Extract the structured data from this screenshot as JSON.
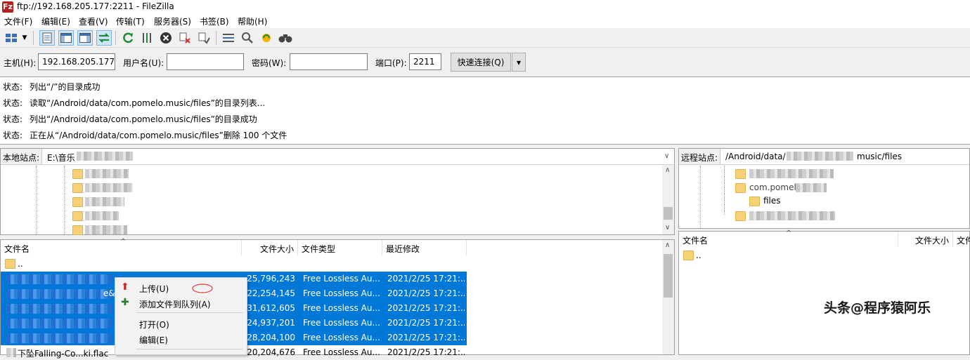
{
  "window": {
    "title": "ftp://192.168.205.177:2211 - FileZilla",
    "app_icon_glyph": "Fz",
    "app_icon_color": "#b51f1f"
  },
  "menu": [
    "文件(F)",
    "编辑(E)",
    "查看(V)",
    "传输(T)",
    "服务器(S)",
    "书签(B)",
    "帮助(H)"
  ],
  "toolbar": {
    "icons": [
      "site-manager-icon",
      "dropdown-arrow-icon",
      "toggle-log-icon",
      "toggle-local-tree-icon",
      "toggle-remote-tree-icon",
      "toggle-transfer-queue-icon",
      "refresh-icon",
      "process-queue-icon",
      "cancel-icon",
      "disconnect-icon",
      "reconnect-icon",
      "directory-filter-icon",
      "compare-directories-icon",
      "sync-browse-icon",
      "search-files-icon"
    ]
  },
  "quickconnect": {
    "host_label": "主机(H):",
    "host_value": "192.168.205.177",
    "user_label": "用户名(U):",
    "user_value": "",
    "pass_label": "密码(W):",
    "pass_value": "",
    "port_label": "端口(P):",
    "port_value": "2211",
    "connect_label": "快速连接(Q)",
    "dropdown_glyph": "▾"
  },
  "log": [
    {
      "label": "状态:",
      "text": "列出“/”的目录成功"
    },
    {
      "label": "状态:",
      "text": "读取“/Android/data/com.pomelo.music/files”的目录列表..."
    },
    {
      "label": "状态:",
      "text": "列出“/Android/data/com.pomelo.music/files”的目录成功"
    },
    {
      "label": "状态:",
      "text": "正在从“/Android/data/com.pomelo.music/files”删除 100 个文件"
    }
  ],
  "local": {
    "site_label": "本地站点:",
    "path": "E:\\音乐",
    "columns": [
      "文件名",
      "文件大小",
      "文件类型",
      "最近修改"
    ],
    "parent_dir": "..",
    "files": [
      {
        "name": "",
        "size": "25,796,243",
        "type": "Free Lossless Au...",
        "modified": "2021/2/25 17:21:...",
        "selected": true
      },
      {
        "name": "e&",
        "size": "22,254,145",
        "type": "Free Lossless Au...",
        "modified": "2021/2/25 17:21:...",
        "selected": true
      },
      {
        "name": "",
        "size": "31,612,605",
        "type": "Free Lossless Au...",
        "modified": "2021/2/25 17:21:...",
        "selected": true
      },
      {
        "name": "",
        "size": "24,937,201",
        "type": "Free Lossless Au...",
        "modified": "2021/2/25 17:21:...",
        "selected": true
      },
      {
        "name": "",
        "size": "28,204,100",
        "type": "Free Lossless Au...",
        "modified": "2021/2/25 17:21:...",
        "selected": true
      },
      {
        "name": "下坠Falling-Co...ki.flac",
        "size": "20,204,676",
        "type": "Free Lossless Au...",
        "modified": "2021/2/25 17:21:...",
        "selected": false
      }
    ]
  },
  "remote": {
    "site_label": "远程站点:",
    "path_start": "/Android/data/",
    "path_end": "music/files",
    "tree_partial": "com.pomelo",
    "tree_files": "files",
    "columns": [
      "文件名",
      "文件大小",
      "文件类"
    ],
    "parent_dir": ".."
  },
  "context_menu": {
    "items": [
      {
        "label": "上传(U)",
        "icon": "upload-arrow-icon",
        "icon_glyph": "⬆",
        "icon_color": "#c62828"
      },
      {
        "label": "添加文件到队列(A)",
        "icon": "add-to-queue-icon",
        "icon_glyph": "✚",
        "icon_color": "#2e7d32"
      },
      {
        "label": "打开(O)",
        "icon": "",
        "icon_glyph": "",
        "icon_color": ""
      },
      {
        "label": "编辑(E)",
        "icon": "",
        "icon_glyph": "",
        "icon_color": ""
      }
    ],
    "annotation_color": "#e53935"
  },
  "watermark": "头条@程序猿阿乐",
  "colors": {
    "selection": "#0078d7",
    "folder": "#f5d277"
  }
}
